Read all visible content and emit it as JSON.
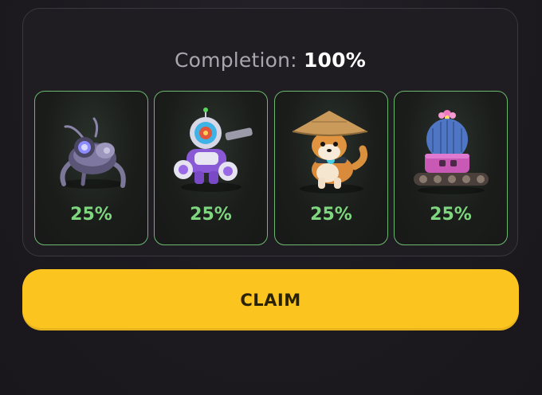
{
  "completion": {
    "label": "Completion:",
    "value": "100%"
  },
  "cards": [
    {
      "name": "robot-bug",
      "percent": "25%",
      "icon": "mech-bug-icon"
    },
    {
      "name": "astronaut-mech",
      "percent": "25%",
      "icon": "astronaut-robot-icon"
    },
    {
      "name": "shiba-dog",
      "percent": "25%",
      "icon": "shiba-straw-hat-icon"
    },
    {
      "name": "cactus-tank",
      "percent": "25%",
      "icon": "cactus-tank-icon"
    }
  ],
  "claim": {
    "label": "CLAIM"
  },
  "colors": {
    "accent_green": "#7ed67e",
    "card_border": "#6bb86f",
    "claim_yellow": "#fbc41f",
    "background": "#1d1b20"
  }
}
